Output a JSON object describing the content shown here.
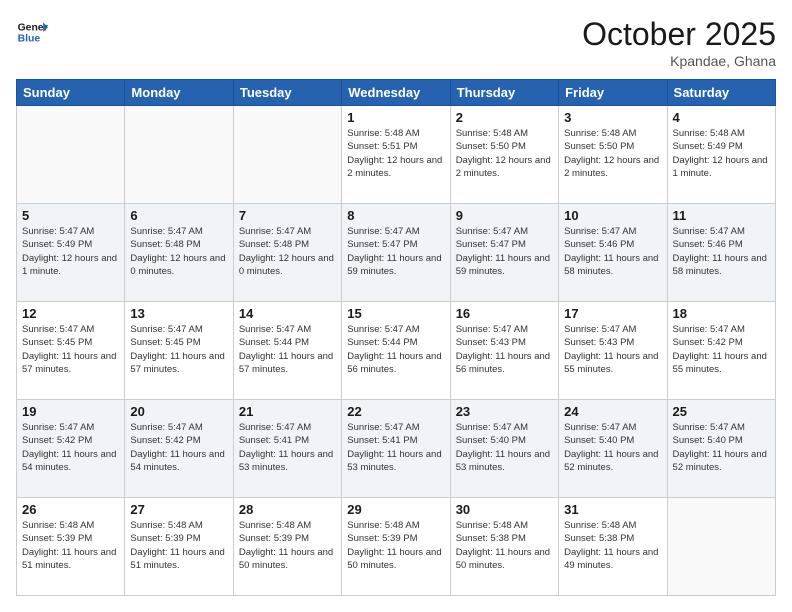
{
  "logo": {
    "line1": "General",
    "line2": "Blue"
  },
  "header": {
    "month": "October 2025",
    "location": "Kpandae, Ghana"
  },
  "weekdays": [
    "Sunday",
    "Monday",
    "Tuesday",
    "Wednesday",
    "Thursday",
    "Friday",
    "Saturday"
  ],
  "weeks": [
    [
      {
        "day": "",
        "info": ""
      },
      {
        "day": "",
        "info": ""
      },
      {
        "day": "",
        "info": ""
      },
      {
        "day": "1",
        "info": "Sunrise: 5:48 AM\nSunset: 5:51 PM\nDaylight: 12 hours\nand 2 minutes."
      },
      {
        "day": "2",
        "info": "Sunrise: 5:48 AM\nSunset: 5:50 PM\nDaylight: 12 hours\nand 2 minutes."
      },
      {
        "day": "3",
        "info": "Sunrise: 5:48 AM\nSunset: 5:50 PM\nDaylight: 12 hours\nand 2 minutes."
      },
      {
        "day": "4",
        "info": "Sunrise: 5:48 AM\nSunset: 5:49 PM\nDaylight: 12 hours\nand 1 minute."
      }
    ],
    [
      {
        "day": "5",
        "info": "Sunrise: 5:47 AM\nSunset: 5:49 PM\nDaylight: 12 hours\nand 1 minute."
      },
      {
        "day": "6",
        "info": "Sunrise: 5:47 AM\nSunset: 5:48 PM\nDaylight: 12 hours\nand 0 minutes."
      },
      {
        "day": "7",
        "info": "Sunrise: 5:47 AM\nSunset: 5:48 PM\nDaylight: 12 hours\nand 0 minutes."
      },
      {
        "day": "8",
        "info": "Sunrise: 5:47 AM\nSunset: 5:47 PM\nDaylight: 11 hours\nand 59 minutes."
      },
      {
        "day": "9",
        "info": "Sunrise: 5:47 AM\nSunset: 5:47 PM\nDaylight: 11 hours\nand 59 minutes."
      },
      {
        "day": "10",
        "info": "Sunrise: 5:47 AM\nSunset: 5:46 PM\nDaylight: 11 hours\nand 58 minutes."
      },
      {
        "day": "11",
        "info": "Sunrise: 5:47 AM\nSunset: 5:46 PM\nDaylight: 11 hours\nand 58 minutes."
      }
    ],
    [
      {
        "day": "12",
        "info": "Sunrise: 5:47 AM\nSunset: 5:45 PM\nDaylight: 11 hours\nand 57 minutes."
      },
      {
        "day": "13",
        "info": "Sunrise: 5:47 AM\nSunset: 5:45 PM\nDaylight: 11 hours\nand 57 minutes."
      },
      {
        "day": "14",
        "info": "Sunrise: 5:47 AM\nSunset: 5:44 PM\nDaylight: 11 hours\nand 57 minutes."
      },
      {
        "day": "15",
        "info": "Sunrise: 5:47 AM\nSunset: 5:44 PM\nDaylight: 11 hours\nand 56 minutes."
      },
      {
        "day": "16",
        "info": "Sunrise: 5:47 AM\nSunset: 5:43 PM\nDaylight: 11 hours\nand 56 minutes."
      },
      {
        "day": "17",
        "info": "Sunrise: 5:47 AM\nSunset: 5:43 PM\nDaylight: 11 hours\nand 55 minutes."
      },
      {
        "day": "18",
        "info": "Sunrise: 5:47 AM\nSunset: 5:42 PM\nDaylight: 11 hours\nand 55 minutes."
      }
    ],
    [
      {
        "day": "19",
        "info": "Sunrise: 5:47 AM\nSunset: 5:42 PM\nDaylight: 11 hours\nand 54 minutes."
      },
      {
        "day": "20",
        "info": "Sunrise: 5:47 AM\nSunset: 5:42 PM\nDaylight: 11 hours\nand 54 minutes."
      },
      {
        "day": "21",
        "info": "Sunrise: 5:47 AM\nSunset: 5:41 PM\nDaylight: 11 hours\nand 53 minutes."
      },
      {
        "day": "22",
        "info": "Sunrise: 5:47 AM\nSunset: 5:41 PM\nDaylight: 11 hours\nand 53 minutes."
      },
      {
        "day": "23",
        "info": "Sunrise: 5:47 AM\nSunset: 5:40 PM\nDaylight: 11 hours\nand 53 minutes."
      },
      {
        "day": "24",
        "info": "Sunrise: 5:47 AM\nSunset: 5:40 PM\nDaylight: 11 hours\nand 52 minutes."
      },
      {
        "day": "25",
        "info": "Sunrise: 5:47 AM\nSunset: 5:40 PM\nDaylight: 11 hours\nand 52 minutes."
      }
    ],
    [
      {
        "day": "26",
        "info": "Sunrise: 5:48 AM\nSunset: 5:39 PM\nDaylight: 11 hours\nand 51 minutes."
      },
      {
        "day": "27",
        "info": "Sunrise: 5:48 AM\nSunset: 5:39 PM\nDaylight: 11 hours\nand 51 minutes."
      },
      {
        "day": "28",
        "info": "Sunrise: 5:48 AM\nSunset: 5:39 PM\nDaylight: 11 hours\nand 50 minutes."
      },
      {
        "day": "29",
        "info": "Sunrise: 5:48 AM\nSunset: 5:39 PM\nDaylight: 11 hours\nand 50 minutes."
      },
      {
        "day": "30",
        "info": "Sunrise: 5:48 AM\nSunset: 5:38 PM\nDaylight: 11 hours\nand 50 minutes."
      },
      {
        "day": "31",
        "info": "Sunrise: 5:48 AM\nSunset: 5:38 PM\nDaylight: 11 hours\nand 49 minutes."
      },
      {
        "day": "",
        "info": ""
      }
    ]
  ]
}
